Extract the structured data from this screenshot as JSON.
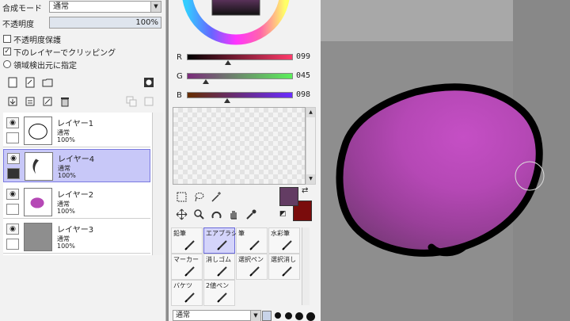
{
  "left_panel": {
    "blend_mode_label": "合成モード",
    "blend_mode_value": "通常",
    "opacity_label": "不透明度",
    "opacity_value": "100%",
    "opacity_fraction": 1.0,
    "checkboxes": [
      {
        "label": "不透明度保護",
        "checked": false
      },
      {
        "label": "下のレイヤーでクリッピング",
        "checked": true
      }
    ],
    "radio": {
      "label": "領域検出元に指定",
      "selected": false
    },
    "layers": [
      {
        "name": "レイヤー1",
        "mode": "通常",
        "opacity": "100%",
        "selected": false,
        "visible": true
      },
      {
        "name": "レイヤー4",
        "mode": "通常",
        "opacity": "100%",
        "selected": true,
        "visible": true
      },
      {
        "name": "レイヤー2",
        "mode": "通常",
        "opacity": "100%",
        "selected": false,
        "visible": true
      },
      {
        "name": "レイヤー3",
        "mode": "通常",
        "opacity": "100%",
        "selected": false,
        "visible": true
      }
    ]
  },
  "color_panel": {
    "sliders": [
      {
        "letter": "R",
        "value": "099",
        "level": 0.39,
        "gradient": "linear-gradient(to right,#000,#ff3b6b)"
      },
      {
        "letter": "G",
        "value": "045",
        "level": 0.18,
        "gradient": "linear-gradient(to right,#7a2b7a,#5cf05c)"
      },
      {
        "letter": "B",
        "value": "098",
        "level": 0.38,
        "gradient": "linear-gradient(to right,#662d00,#6a2dff)"
      }
    ],
    "main_color": "#633c63",
    "secondary_color": "#7a0c0c"
  },
  "brush_tools": [
    {
      "label": "鉛筆",
      "active": false
    },
    {
      "label": "エアブラシ",
      "active": true
    },
    {
      "label": "筆",
      "active": false
    },
    {
      "label": "水彩筆",
      "active": false
    },
    {
      "label": "マーカー",
      "active": false
    },
    {
      "label": "消しゴム",
      "active": false
    },
    {
      "label": "選択ペン",
      "active": false
    },
    {
      "label": "選択消し",
      "active": false
    },
    {
      "label": "バケツ",
      "active": false
    },
    {
      "label": "2値ペン",
      "active": false
    }
  ],
  "brush_mode": "通常",
  "colors": {
    "canvas_bg": "#8e8e8e",
    "blob_fill": "#b548b5",
    "blob_shadow": "#8a3a8a",
    "outline": "#000000"
  }
}
